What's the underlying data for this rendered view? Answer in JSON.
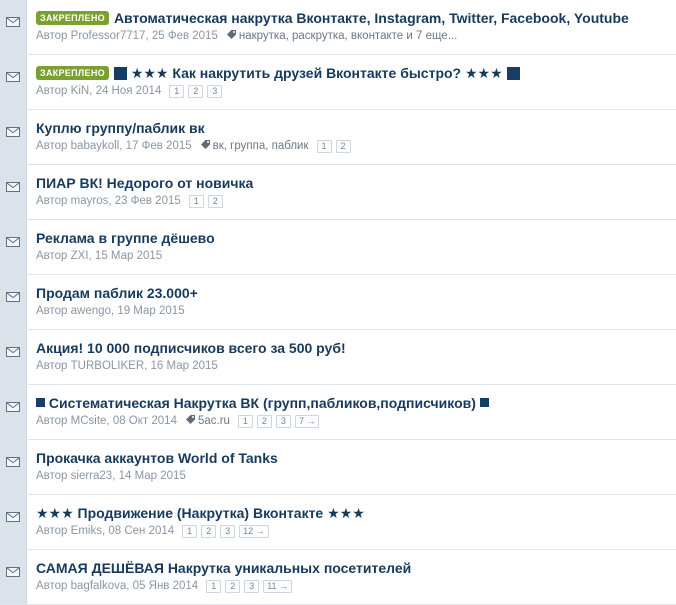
{
  "threads": [
    {
      "sticky": true,
      "badge": "ЗАКРЕПЛЕНО",
      "title": "Автоматическая накрутка Вконтакте, Instagram, Twitter, Facebook, Youtube",
      "author": "Автор Professor7717, 25 Фев 2015",
      "tags": "накрутка, раскрутка, вконтакте и 7 еще...",
      "pages": []
    },
    {
      "sticky": true,
      "badge": "ЗАКРЕПЛЕНО",
      "title": "★★★ Как накрутить друзей Вконтакте быстро? ★★★",
      "deco": "big",
      "author": "Автор KiN, 24 Ноя 2014",
      "tags": "",
      "pages": [
        "1",
        "2",
        "3"
      ]
    },
    {
      "title": "Куплю группу/паблик вк",
      "author": "Автор babaykoll, 17 Фев 2015",
      "tags": "вк, группа, паблик",
      "pages": [
        "1",
        "2"
      ]
    },
    {
      "title": "ПИАР ВК! Недорого от новичка",
      "author": "Автор mayros, 23 Фев 2015",
      "tags": "",
      "pages": [
        "1",
        "2"
      ]
    },
    {
      "title": "Реклама в группе дёшево",
      "author": "Автор ZXI, 15 Мар 2015",
      "tags": "",
      "pages": []
    },
    {
      "title": "Продам паблик 23.000+",
      "author": "Автор awengo, 19 Мар 2015",
      "tags": "",
      "pages": []
    },
    {
      "title": "Акция! 10 000 подписчиков всего за 500 руб!",
      "author": "Автор TURBOLIKER, 16 Мар 2015",
      "tags": "",
      "pages": []
    },
    {
      "title": "Систематическая Накрутка ВК (групп,пабликов,подписчиков)",
      "deco": "small",
      "author": "Автор MCsite, 08 Окт 2014",
      "tags": "5ac.ru",
      "pages": [
        "1",
        "2",
        "3",
        "7 →"
      ]
    },
    {
      "title": "Прокачка аккаунтов World of Tanks",
      "author": "Автор sierra23, 14 Мар 2015",
      "tags": "",
      "pages": []
    },
    {
      "title": "★★★ Продвижение (Накрутка) Вконтакте ★★★",
      "author": "Автор Emiks, 08 Сен 2014",
      "tags": "",
      "pages": [
        "1",
        "2",
        "3",
        "12 →"
      ]
    },
    {
      "title": "САМАЯ ДЕШЁВАЯ Накрутка уникальных посетителей",
      "author": "Автор bagfalkova, 05 Янв 2014",
      "tags": "",
      "pages": [
        "1",
        "2",
        "3",
        "11 →"
      ]
    }
  ],
  "icons": {
    "status": "envelope-icon",
    "tag": "tag-icon"
  },
  "colors": {
    "badge": "#7aa031",
    "title": "#173a5c",
    "meta": "#8a96a3",
    "gutter": "#dbe2ea"
  }
}
